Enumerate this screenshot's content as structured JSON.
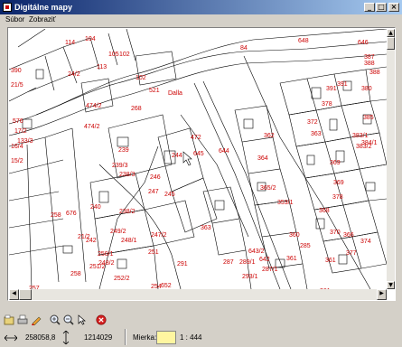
{
  "window": {
    "title": "Digitálne mapy",
    "minimize": "_",
    "maximize": "□",
    "close": "×"
  },
  "menu": {
    "items": [
      "Súbor",
      "Zobraziť"
    ]
  },
  "map": {
    "labels": [
      "114",
      "104",
      "105",
      "102",
      "84",
      "648",
      "646",
      "387",
      "388",
      "388",
      "390",
      "24/2",
      "113",
      "102",
      "521",
      "Dalla",
      "391",
      "391",
      "380",
      "378",
      "21/5",
      "576",
      "474/2",
      "268",
      "372",
      "385",
      "17/2",
      "133/3",
      "474/2",
      "472",
      "383/1",
      "384/1",
      "16/4",
      "239",
      "244",
      "645",
      "363",
      "362",
      "383/2",
      "15/2",
      "239/3",
      "238/3",
      "644",
      "364",
      "369",
      "378",
      "246",
      "365/2",
      "247",
      "238/2",
      "245",
      "353/1",
      "369",
      "258",
      "676",
      "240",
      "363",
      "368",
      "370",
      "361",
      "249/2",
      "248/1",
      "247/2",
      "360",
      "366",
      "374",
      "21/2",
      "242",
      "250/1",
      "291",
      "287",
      "377",
      "248/2",
      "251",
      "643/2",
      "285",
      "361",
      "289/1",
      "642",
      "258",
      "251/2",
      "252/2",
      "293/1",
      "287/1",
      "257",
      "254",
      "652",
      "284",
      "361"
    ],
    "cursor_label": "arrow-cursor"
  },
  "toolbar": {
    "icons": [
      "open-icon",
      "print-icon",
      "pencil-icon",
      "zoom-in-icon",
      "zoom-out-icon",
      "select-arrow-icon",
      "stop-icon"
    ]
  },
  "status": {
    "x_coord": "258058,8",
    "y_coord": "1214029",
    "scale_label": "Mierka:",
    "scale_value": "1 : 444"
  },
  "colors": {
    "title_start": "#0a246a",
    "title_end": "#a6caf0",
    "parcel_label": "#cc0000",
    "map_line": "#000000"
  }
}
